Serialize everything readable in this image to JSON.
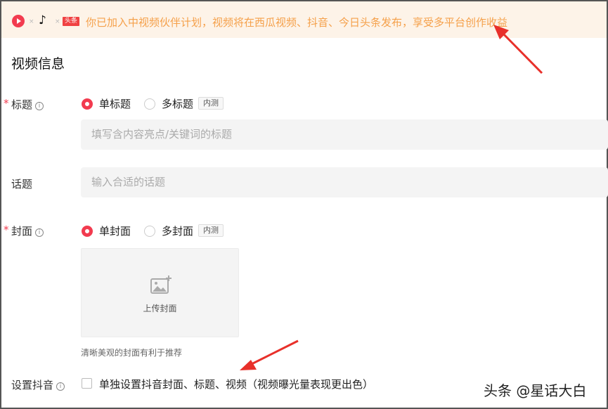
{
  "banner": {
    "sep": "×",
    "douyin_glyph": "♪",
    "toutiao_label": "头条",
    "text": "你已加入中视频伙伴计划，视频将在西瓜视频、抖音、今日头条发布，享受多平台创作收益"
  },
  "section_title": "视频信息",
  "required_mark": "*",
  "info_glyph": "i",
  "title_field": {
    "label": "标题",
    "option_single": "单标题",
    "option_multi": "多标题",
    "badge": "内测",
    "placeholder": "填写含内容亮点/关键词的标题"
  },
  "topic_field": {
    "label": "话题",
    "placeholder": "输入合适的话题"
  },
  "cover_field": {
    "label": "封面",
    "option_single": "单封面",
    "option_multi": "多封面",
    "badge": "内测",
    "upload_label": "上传封面",
    "hint": "清晰美观的封面有利于推荐"
  },
  "douyin_setting": {
    "label": "设置抖音",
    "checkbox_label": "单独设置抖音封面、标题、视频（视频曝光量表现更出色）"
  },
  "watermark": "头条 @星话大白",
  "colors": {
    "accent": "#f23b4f",
    "banner_bg": "#fdf3e8",
    "banner_text": "#f5a04a",
    "arrow": "#e8302a"
  }
}
